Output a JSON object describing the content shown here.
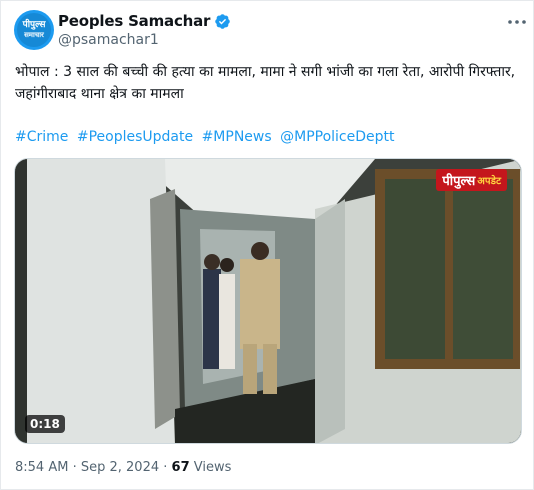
{
  "author": {
    "display_name": "Peoples Samachar",
    "handle": "@psamachar1",
    "avatar_text_line1": "पीपुल्स",
    "avatar_text_line2": "समाचार",
    "verified": true
  },
  "tweet": {
    "text": "भोपाल : 3 साल की बच्ची की हत्या का मामला, मामा ने सगी भांजी का गला रेता, आरोपी गिरफ्तार, जहांगीराबाद थाना क्षेत्र का मामला",
    "hashtags": [
      "#Crime",
      "#PeoplesUpdate",
      "#MPNews",
      "@MPPoliceDeptt"
    ]
  },
  "media": {
    "logo_main": "पीपुल्स",
    "logo_sub": "अपडेट",
    "duration": "0:18"
  },
  "meta": {
    "time": "8:54 AM",
    "separator": "·",
    "date": "Sep 2, 2024",
    "views_count": "67",
    "views_label": "Views"
  },
  "colors": {
    "accent": "#1d9bf0",
    "text": "#0f1419",
    "muted": "#536471",
    "badge_red": "#c4161c"
  },
  "icons": [
    "verified-badge-icon",
    "more-icon"
  ]
}
